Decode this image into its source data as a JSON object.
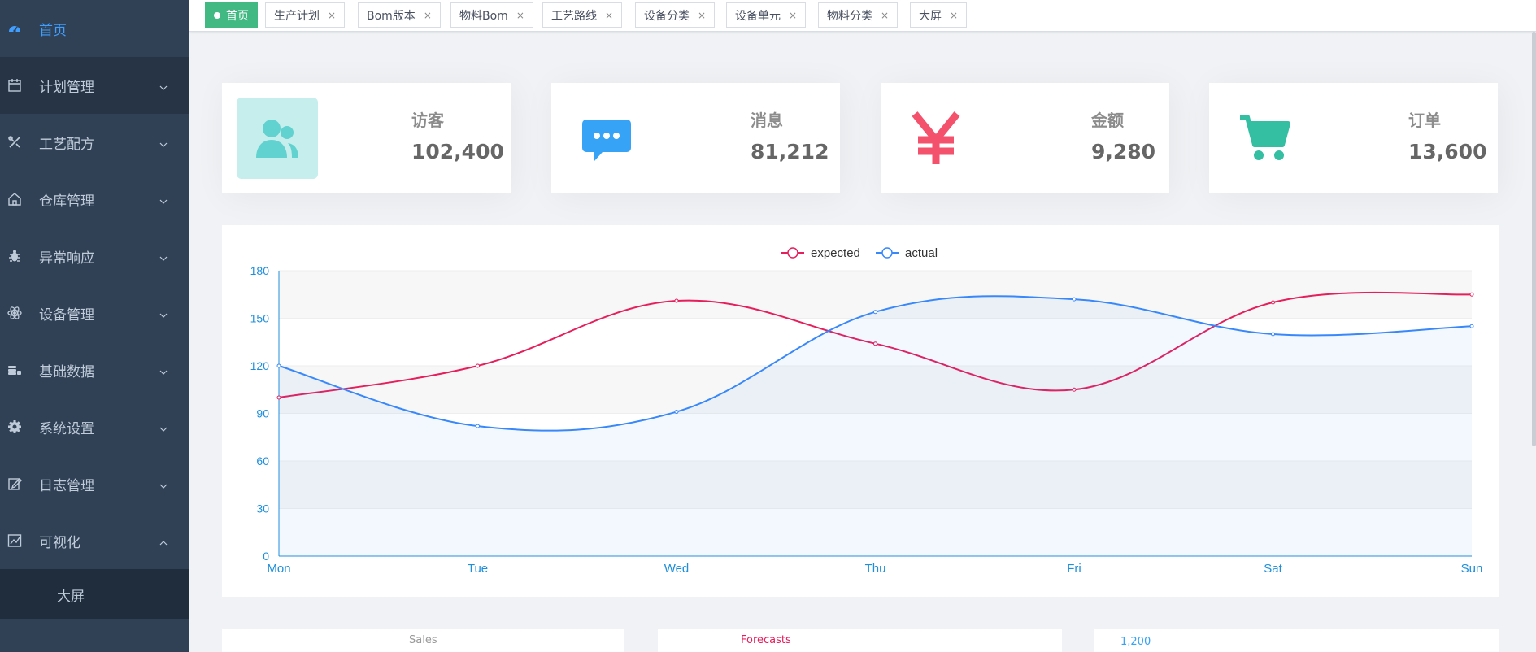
{
  "sidebar": {
    "items": [
      {
        "label": "首页",
        "icon": "dashboard-icon"
      },
      {
        "label": "计划管理",
        "icon": "calendar-icon"
      },
      {
        "label": "工艺配方",
        "icon": "tools-icon"
      },
      {
        "label": "仓库管理",
        "icon": "warehouse-icon"
      },
      {
        "label": "异常响应",
        "icon": "bug-icon"
      },
      {
        "label": "设备管理",
        "icon": "atom-icon"
      },
      {
        "label": "基础数据",
        "icon": "database-icon"
      },
      {
        "label": "系统设置",
        "icon": "gear-icon"
      },
      {
        "label": "日志管理",
        "icon": "log-edit-icon"
      },
      {
        "label": "可视化",
        "icon": "chart-icon"
      }
    ],
    "subitem": "大屏"
  },
  "tags": [
    {
      "label": "首页",
      "active": true
    },
    {
      "label": "生产计划"
    },
    {
      "label": "Bom版本"
    },
    {
      "label": "物料Bom"
    },
    {
      "label": "工艺路线"
    },
    {
      "label": "设备分类"
    },
    {
      "label": "设备单元"
    },
    {
      "label": "物料分类"
    },
    {
      "label": "大屏"
    }
  ],
  "close_glyph": "×",
  "cards": [
    {
      "label": "访客",
      "value": "102,400",
      "icon": "people-icon",
      "color": "#40c9c6"
    },
    {
      "label": "消息",
      "value": "81,212",
      "icon": "message-icon",
      "color": "#36a3f7"
    },
    {
      "label": "金额",
      "value": "9,280",
      "icon": "yen-icon",
      "color": "#f4516c"
    },
    {
      "label": "订单",
      "value": "13,600",
      "icon": "cart-icon",
      "color": "#34bfa3"
    }
  ],
  "chart_data": {
    "type": "line",
    "categories": [
      "Mon",
      "Tue",
      "Wed",
      "Thu",
      "Fri",
      "Sat",
      "Sun"
    ],
    "series": [
      {
        "name": "expected",
        "values": [
          100,
          120,
          161,
          134,
          105,
          160,
          165
        ],
        "color": "#e51e5c"
      },
      {
        "name": "actual",
        "values": [
          120,
          82,
          91,
          154,
          162,
          140,
          145
        ],
        "color": "#3888fa"
      }
    ],
    "ylim": [
      0,
      180
    ],
    "yticks": [
      0,
      30,
      60,
      90,
      120,
      150,
      180
    ],
    "legend": "top-center",
    "grid": true,
    "smooth": true
  },
  "mini_panels": [
    {
      "title": "Sales"
    },
    {
      "title": "Forecasts"
    },
    {
      "title": "1,200"
    }
  ]
}
